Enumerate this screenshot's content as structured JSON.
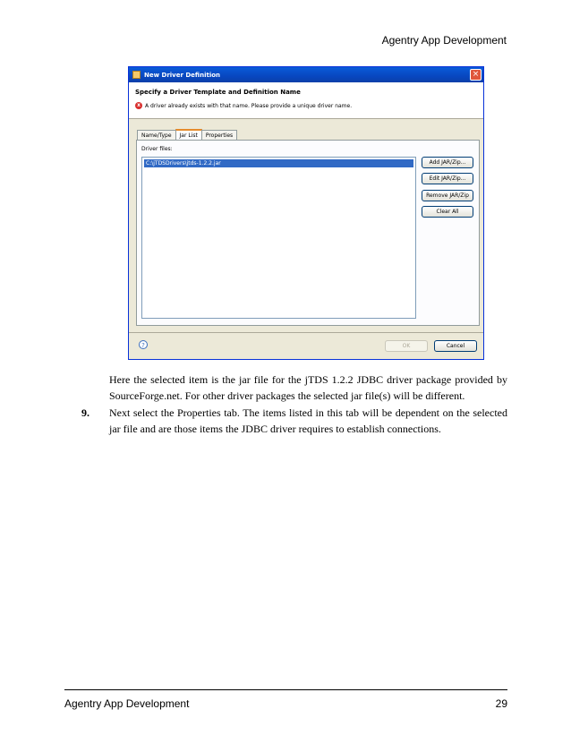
{
  "header": {
    "title": "Agentry App Development"
  },
  "dialog": {
    "title": "New Driver Definition",
    "close_symbol": "×",
    "banner_title": "Specify a Driver Template and Definition Name",
    "error_symbol": "x",
    "error_message": "A driver already exists with that name. Please provide a unique driver name.",
    "tabs": [
      "Name/Type",
      "Jar List",
      "Properties"
    ],
    "driver_files_label": "Driver files:",
    "files": [
      "C:\\jTDSDrivers\\jtds-1.2.2.jar"
    ],
    "side_buttons": [
      "Add JAR/Zip...",
      "Edit JAR/Zip...",
      "Remove JAR/Zip",
      "Clear All"
    ],
    "help_symbol": "?",
    "ok_label": "OK",
    "cancel_label": "Cancel"
  },
  "body": {
    "paragraph": "Here the selected item is the jar file for the jTDS 1.2.2 JDBC driver package provided by SourceForge.net. For other driver packages the selected jar file(s) will be different.",
    "step_number": "9.",
    "step_text": "Next select the Properties tab. The items listed in this tab will be dependent on the selected jar file and are those items the JDBC driver requires to establish connections."
  },
  "footer": {
    "left": "Agentry App Development",
    "page_number": "29"
  }
}
